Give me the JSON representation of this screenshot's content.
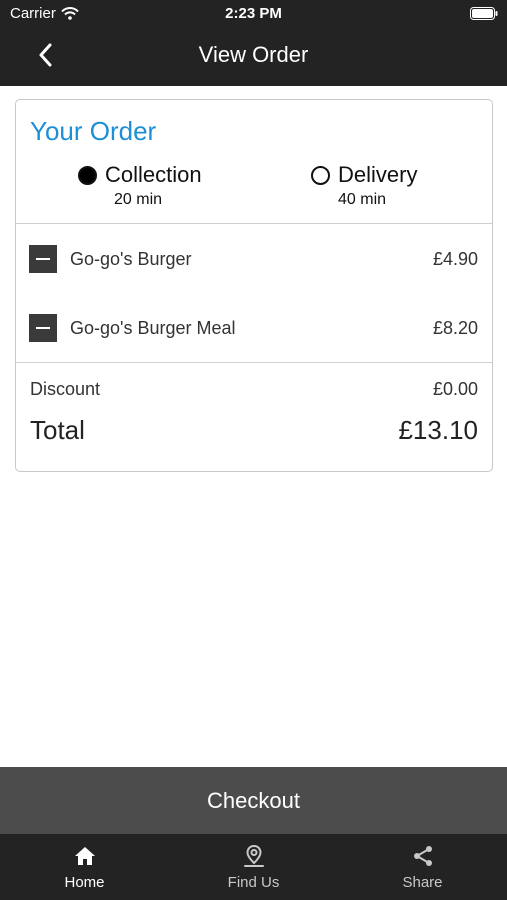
{
  "status_bar": {
    "carrier": "Carrier",
    "time": "2:23 PM"
  },
  "navbar": {
    "title": "View Order",
    "back_icon": "chevron-left-icon"
  },
  "order_card": {
    "title": "Your Order",
    "options": [
      {
        "label": "Collection",
        "time": "20 min",
        "selected": true
      },
      {
        "label": "Delivery",
        "time": "40 min",
        "selected": false
      }
    ],
    "items": [
      {
        "name": "Go-go's Burger",
        "price": "£4.90"
      },
      {
        "name": "Go-go's Burger Meal",
        "price": "£8.20"
      }
    ],
    "discount_label": "Discount",
    "discount_value": "£0.00",
    "total_label": "Total",
    "total_value": "£13.10"
  },
  "checkout_label": "Checkout",
  "tabs": [
    {
      "label": "Home",
      "icon": "home-icon",
      "active": true
    },
    {
      "label": "Find Us",
      "icon": "map-pin-icon",
      "active": false
    },
    {
      "label": "Share",
      "icon": "share-icon",
      "active": false
    }
  ],
  "colors": {
    "bar_background": "#232323",
    "accent_blue": "#1c8fd6",
    "checkout_background": "#4c4c4c",
    "active_tab": "#ffffff",
    "inactive_tab": "#c8c8c8"
  }
}
